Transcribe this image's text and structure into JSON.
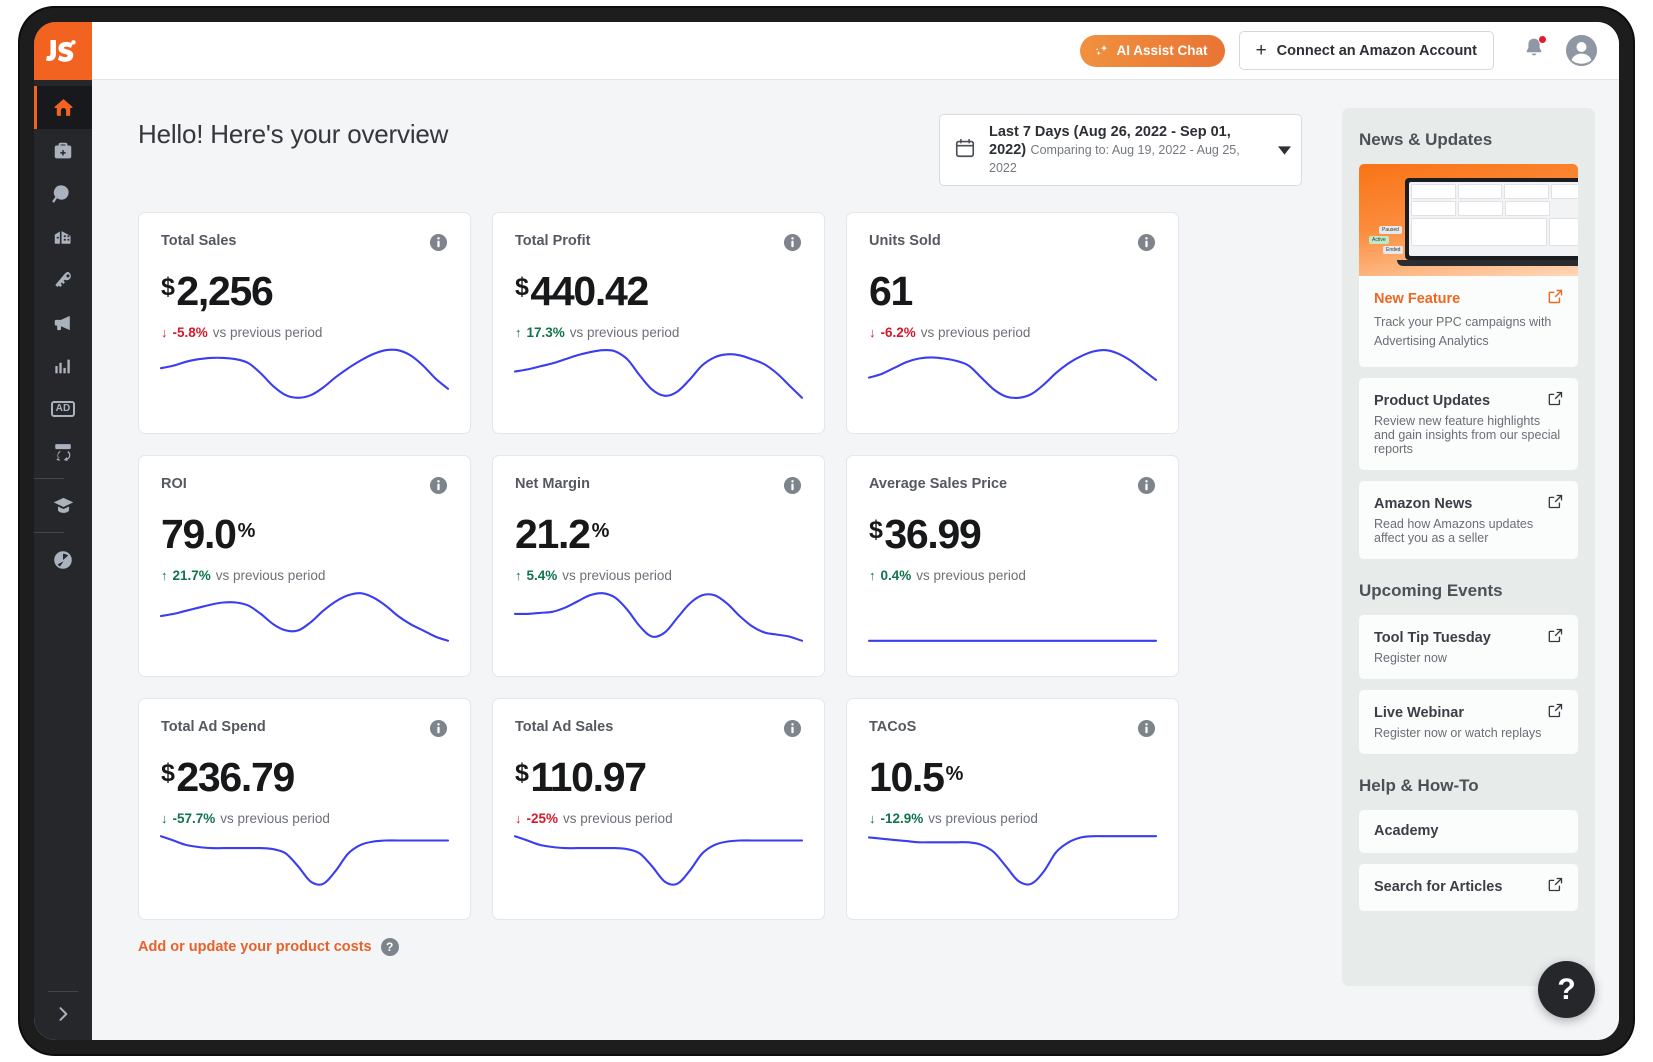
{
  "brand": {
    "logo_text": "JS",
    "accent": "#f26322"
  },
  "sidebar": {
    "items": [
      {
        "name": "home",
        "label": "Home",
        "icon": "home-icon",
        "active": true
      },
      {
        "name": "toolbox",
        "label": "Toolbox",
        "icon": "toolbox-icon",
        "active": false
      },
      {
        "name": "opportunity-finder",
        "label": "Opportunity Finder",
        "icon": "magnifier-icon",
        "active": false
      },
      {
        "name": "product-database",
        "label": "Product Database",
        "icon": "buildings-icon",
        "active": false
      },
      {
        "name": "keyword-scout",
        "label": "Keyword Scout",
        "icon": "key-icon",
        "active": false
      },
      {
        "name": "promotions",
        "label": "Promotions",
        "icon": "megaphone-icon",
        "active": false
      },
      {
        "name": "analytics",
        "label": "Analytics",
        "icon": "bar-chart-icon",
        "active": false
      },
      {
        "name": "advertising",
        "label": "Advertising",
        "icon": "ad-badge-icon",
        "active": false
      },
      {
        "name": "inventory",
        "label": "Inventory",
        "icon": "box-refresh-icon",
        "active": false
      },
      {
        "name": "academy",
        "label": "Academy",
        "icon": "graduation-cap-icon",
        "active": false
      },
      {
        "name": "extension",
        "label": "Extension",
        "icon": "jungle-scout-mark-icon",
        "active": false
      }
    ],
    "expand_label": ">"
  },
  "topbar": {
    "ai_chat_label": "AI Assist Chat",
    "connect_label": "Connect an Amazon Account",
    "plus": "+",
    "notifications_icon": "bell-icon",
    "avatar_icon": "user-avatar-icon"
  },
  "header": {
    "greeting": "Hello! Here's your overview"
  },
  "date_picker": {
    "icon": "calendar-icon",
    "range": "Last 7 Days (Aug 26, 2022 - Sep 01, 2022)",
    "comparing": "Comparing to: Aug 19, 2022 - Aug 25, 2022",
    "caret": "chevron-down-icon"
  },
  "cards": [
    {
      "title": "Total Sales",
      "currency": "$",
      "value": "2,256",
      "suffix": "",
      "arrow": "↓",
      "delta": "-5.8%",
      "delta_dir": "down",
      "delta_color": "red",
      "note": "vs previous period",
      "info": "info-icon",
      "spark": [
        34,
        36,
        39,
        41,
        42,
        42,
        41,
        38,
        30,
        20,
        13,
        11,
        13,
        19,
        27,
        34,
        40,
        45,
        48,
        48,
        44,
        36,
        26,
        18
      ]
    },
    {
      "title": "Total Profit",
      "currency": "$",
      "value": "440.42",
      "suffix": "",
      "arrow": "↑",
      "delta": "17.3%",
      "delta_dir": "up",
      "delta_color": "green",
      "note": "vs previous period",
      "info": "info-icon",
      "spark": [
        30,
        32,
        35,
        38,
        42,
        46,
        49,
        51,
        50,
        42,
        26,
        12,
        6,
        10,
        22,
        36,
        44,
        47,
        46,
        42,
        37,
        28,
        16,
        4
      ]
    },
    {
      "title": "Units Sold",
      "currency": "",
      "value": "61",
      "suffix": "",
      "arrow": "↓",
      "delta": "-6.2%",
      "delta_dir": "down",
      "delta_color": "red",
      "note": "vs previous period",
      "info": "info-icon",
      "spark": [
        26,
        29,
        34,
        39,
        42,
        43,
        42,
        40,
        36,
        26,
        16,
        10,
        9,
        12,
        20,
        30,
        38,
        44,
        48,
        49,
        46,
        40,
        32,
        24
      ]
    },
    {
      "title": "ROI",
      "currency": "",
      "value": "79.0",
      "suffix": "%",
      "arrow": "↑",
      "delta": "21.7%",
      "delta_dir": "up",
      "delta_color": "green",
      "note": "vs previous period",
      "info": "info-icon",
      "spark": [
        32,
        34,
        37,
        40,
        43,
        45,
        45,
        42,
        34,
        24,
        18,
        18,
        26,
        37,
        46,
        52,
        54,
        50,
        42,
        32,
        24,
        18,
        12,
        8
      ]
    },
    {
      "title": "Net Margin",
      "currency": "",
      "value": "21.2",
      "suffix": "%",
      "arrow": "↑",
      "delta": "5.4%",
      "delta_dir": "up",
      "delta_color": "green",
      "note": "vs previous period",
      "info": "info-icon",
      "spark": [
        32,
        32,
        33,
        34,
        38,
        44,
        50,
        52,
        48,
        36,
        20,
        10,
        14,
        28,
        42,
        50,
        50,
        42,
        30,
        20,
        14,
        12,
        10,
        6
      ]
    },
    {
      "title": "Average Sales Price",
      "currency": "$",
      "value": "36.99",
      "suffix": "",
      "arrow": "↑",
      "delta": "0.4%",
      "delta_dir": "up",
      "delta_color": "green",
      "note": "vs previous period",
      "info": "info-icon",
      "spark": [
        30,
        30,
        30,
        30,
        30,
        30,
        30,
        30,
        30,
        30,
        30,
        30,
        30,
        30,
        30,
        30,
        30,
        30,
        30,
        30,
        30,
        30,
        30,
        30
      ]
    },
    {
      "title": "Total Ad Spend",
      "currency": "$",
      "value": "236.79",
      "suffix": "",
      "arrow": "↓",
      "delta": "-57.7%",
      "delta_dir": "down",
      "delta_color": "green",
      "note": "vs previous period",
      "info": "info-icon",
      "spark": [
        46,
        42,
        38,
        36,
        35,
        35,
        35,
        35,
        35,
        34,
        30,
        18,
        4,
        2,
        14,
        30,
        38,
        41,
        42,
        42,
        42,
        42,
        42,
        42
      ]
    },
    {
      "title": "Total Ad Sales",
      "currency": "$",
      "value": "110.97",
      "suffix": "",
      "arrow": "↓",
      "delta": "-25%",
      "delta_dir": "down",
      "delta_color": "red",
      "note": "vs previous period",
      "info": "info-icon",
      "spark": [
        46,
        42,
        38,
        36,
        35,
        35,
        35,
        35,
        35,
        34,
        30,
        18,
        4,
        2,
        14,
        30,
        38,
        41,
        42,
        42,
        42,
        42,
        42,
        42
      ]
    },
    {
      "title": "TACoS",
      "currency": "",
      "value": "10.5",
      "suffix": "%",
      "arrow": "↓",
      "delta": "-12.9%",
      "delta_dir": "down",
      "delta_color": "green",
      "note": "vs previous period",
      "info": "info-icon",
      "spark": [
        40,
        39,
        38,
        37,
        36,
        36,
        36,
        36,
        36,
        34,
        28,
        16,
        4,
        2,
        12,
        28,
        36,
        40,
        41,
        41,
        41,
        41,
        41,
        41
      ]
    }
  ],
  "costs_link": {
    "label": "Add or update your product costs",
    "help_icon": "question-mark-icon",
    "help_glyph": "?"
  },
  "news_panel": {
    "heading": "News & Updates",
    "featured": {
      "title": "New Feature",
      "desc": "Track your PPC campaigns with Advertising Analytics",
      "link_icon": "external-link-icon"
    },
    "items": [
      {
        "title": "Product Updates",
        "desc": "Review new feature highlights and gain insights from our special reports",
        "link_icon": "external-link-icon"
      },
      {
        "title": "Amazon News",
        "desc": "Read how Amazons updates affect you as a seller",
        "link_icon": "external-link-icon"
      }
    ],
    "hero_tags": [
      "Paused",
      "Active",
      "Ended"
    ]
  },
  "events_panel": {
    "heading": "Upcoming Events",
    "items": [
      {
        "title": "Tool Tip Tuesday",
        "desc": "Register now",
        "link_icon": "external-link-icon"
      },
      {
        "title": "Live Webinar",
        "desc": "Register now or watch replays",
        "link_icon": "external-link-icon"
      }
    ]
  },
  "help_panel": {
    "heading": "Help & How-To",
    "items": [
      {
        "title": "Academy",
        "desc": "",
        "link_icon": ""
      },
      {
        "title": "Search for Articles",
        "desc": "",
        "link_icon": "external-link-icon"
      }
    ]
  },
  "fab": {
    "glyph": "?",
    "icon": "question-mark-icon"
  }
}
